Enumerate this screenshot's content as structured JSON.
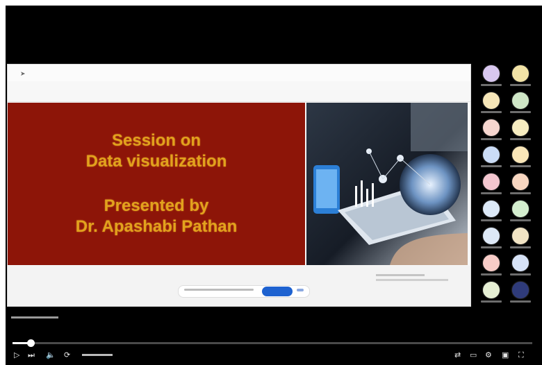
{
  "slide": {
    "title_line1": "Session on",
    "title_line2": "Data visualization",
    "presenter_line1": "Presented by",
    "presenter_line2": "Dr. Apashabi Pathan",
    "colors": {
      "panel": "#8d1508",
      "title": "#e2a21d"
    }
  },
  "participants": [
    {
      "color": "#d8c7ef"
    },
    {
      "color": "#f2e3a6"
    },
    {
      "color": "#f6e6b8"
    },
    {
      "color": "#cfe6c6"
    },
    {
      "color": "#f6d6cf"
    },
    {
      "color": "#f6ecc0"
    },
    {
      "color": "#cbdcf6"
    },
    {
      "color": "#f9e6b8"
    },
    {
      "color": "#f3c6cf"
    },
    {
      "color": "#f7d6c0"
    },
    {
      "color": "#dce9f7"
    },
    {
      "color": "#d4eecf"
    },
    {
      "color": "#dde8f6"
    },
    {
      "color": "#f1e4c4"
    },
    {
      "color": "#f7ccc7"
    },
    {
      "color": "#d6e2f6"
    },
    {
      "color": "#e6efd4"
    },
    {
      "color": "#2f3b7a"
    }
  ],
  "player": {
    "progress_fraction": 0.035,
    "icons": {
      "left": [
        "play-icon",
        "next-icon",
        "volume-icon",
        "autoplay-icon"
      ],
      "right": [
        "autoplay-toggle-icon",
        "subtitles-icon",
        "settings-icon",
        "miniplayer-icon",
        "fullscreen-icon"
      ]
    }
  }
}
